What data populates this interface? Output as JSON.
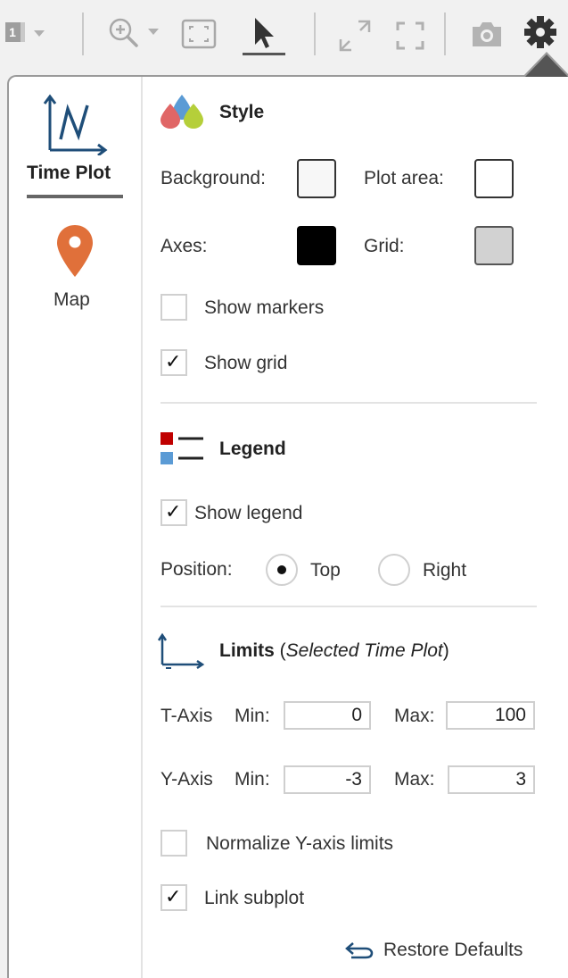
{
  "toolbar": {
    "subplot_badge": "1",
    "icons": [
      "subplot-layout-icon",
      "zoom-in-icon",
      "fit-to-view-icon",
      "pointer-icon",
      "expand-icon",
      "fullscreen-icon",
      "camera-icon",
      "gear-icon"
    ]
  },
  "sidebar": {
    "items": [
      {
        "label": "Time Plot",
        "icon": "time-plot-icon",
        "selected": true
      },
      {
        "label": "Map",
        "icon": "map-pin-icon",
        "selected": false
      }
    ]
  },
  "style": {
    "title": "Style",
    "background_label": "Background:",
    "plot_area_label": "Plot area:",
    "axes_label": "Axes:",
    "grid_label": "Grid:",
    "show_markers_label": "Show markers",
    "show_markers_checked": false,
    "show_grid_label": "Show grid",
    "show_grid_checked": true,
    "check_mark": "✓",
    "colors": {
      "background": "#f7f7f7",
      "plot_area": "#ffffff",
      "axes": "#000000",
      "grid": "#d2d2d2"
    }
  },
  "legend": {
    "title": "Legend",
    "show_legend_label": "Show legend",
    "show_legend_checked": true,
    "position_label": "Position:",
    "top_label": "Top",
    "right_label": "Right",
    "selected_position": "Top"
  },
  "limits": {
    "title": "Limits",
    "subtitle_open": " (",
    "subtitle_italic": "Selected Time Plot",
    "subtitle_close": ")",
    "t_axis_label": "T-Axis",
    "y_axis_label": "Y-Axis",
    "min_label": "Min:",
    "max_label": "Max:",
    "t_min": "0",
    "t_max": "100",
    "y_min": "-3",
    "y_max": "3",
    "normalize_label": "Normalize Y-axis limits",
    "normalize_checked": false,
    "link_subplot_label": "Link subplot",
    "link_subplot_checked": true
  },
  "restore_defaults_label": "Restore Defaults",
  "colors": {
    "map_pin": "#e0703a",
    "time_plot_icon": "#1f4e79",
    "legend_red": "#c00000",
    "legend_blue": "#5b9bd5"
  }
}
